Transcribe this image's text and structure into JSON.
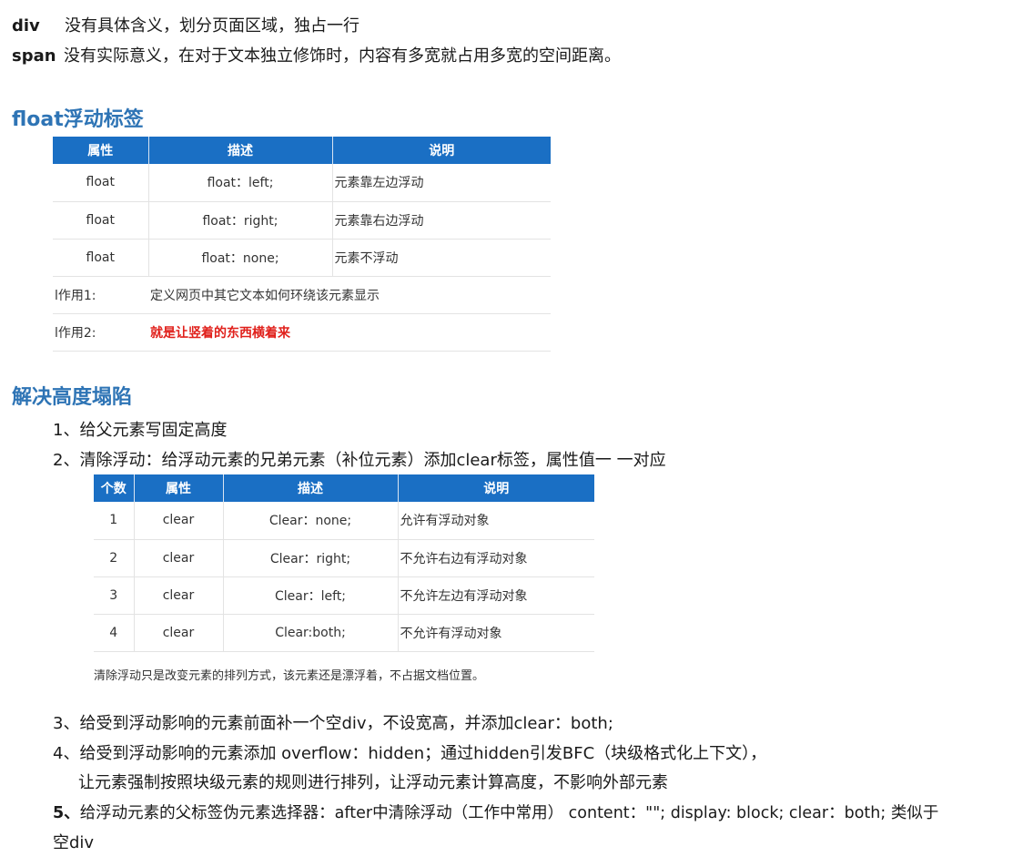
{
  "intro": [
    {
      "term": "div",
      "desc": "没有具体含义，划分页面区域，独占一行"
    },
    {
      "term": "span",
      "desc": "没有实际意义，在对于文本独立修饰时，内容有多宽就占用多宽的空间距离。"
    }
  ],
  "float_section": {
    "heading": "float浮动标签",
    "headers": [
      "属性",
      "描述",
      "说明"
    ],
    "rows": [
      [
        "float",
        "float：left;",
        "元素靠左边浮动"
      ],
      [
        "float",
        "float：right;",
        "元素靠右边浮动"
      ],
      [
        "float",
        "float：none;",
        "元素不浮动"
      ]
    ],
    "uses": [
      {
        "label": "l作用1:",
        "text": "定义网页中其它文本如何环绕该元素显示"
      },
      {
        "label": "l作用2:",
        "text": "就是让竖着的东西横着来"
      }
    ]
  },
  "collapse_section": {
    "heading": "解决高度塌陷",
    "items": [
      "1、给父元素写固定高度",
      "2、清除浮动：给浮动元素的兄弟元素（补位元素）添加clear标签，属性值一 一对应"
    ],
    "clear_table": {
      "headers": [
        "个数",
        "属性",
        "描述",
        "说明"
      ],
      "rows": [
        [
          "1",
          "clear",
          "Clear：none;",
          "允许有浮动对象"
        ],
        [
          "2",
          "clear",
          "Clear：right;",
          "不允许右边有浮动对象"
        ],
        [
          "3",
          "clear",
          "Clear：left;",
          "不允许左边有浮动对象"
        ],
        [
          "4",
          "clear",
          "Clear:both;",
          "不允许有浮动对象"
        ]
      ],
      "note": "清除浮动只是改变元素的排列方式，该元素还是漂浮着，不占据文档位置。"
    },
    "items_after": [
      "3、给受到浮动影响的元素前面补一个空div，不设宽高，并添加clear：both;",
      "4、给受到浮动影响的元素添加 overflow：hidden；通过hidden引发BFC（块级格式化上下文），",
      "让元素强制按照块级元素的规则进行排列，让浮动元素计算高度，不影响外部元素"
    ],
    "item5_num": "5、",
    "item5_text": "给浮动元素的父标签伪元素选择器：after中清除浮动（工作中常用） content：\"\"; display: block;  clear：both;    类似于",
    "item5_cont": "空div"
  }
}
